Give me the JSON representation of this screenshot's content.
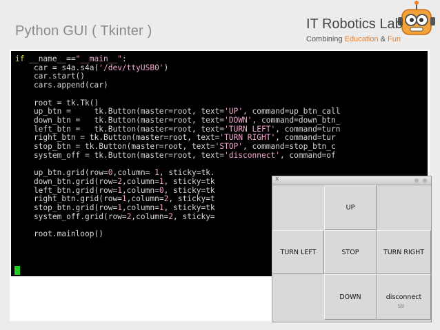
{
  "slide": {
    "title": "Python GUI ( Tkinter )",
    "brand_name": "IT Robotics Lab",
    "brand_tag_prefix": "Combining ",
    "brand_tag_education": "Education",
    "brand_tag_amp": " & ",
    "brand_tag_fun": "Fun",
    "page_number": "59",
    "accent_color": "#ef7d21"
  },
  "code_lines": [
    "if __name__==\"__main__\":",
    "    car = s4a.s4a('/dev/ttyUSB0')",
    "    car.start()",
    "    cars.append(car)",
    "",
    "    root = tk.Tk()",
    "    up_btn =     tk.Button(master=root, text='UP', command=up_btn_call",
    "    down_btn =   tk.Button(master=root, text='DOWN', command=down_btn_",
    "    left_btn =   tk.Button(master=root, text='TURN LEFT', command=turn",
    "    right_btn = tk.Button(master=root, text='TURN RIGHT', command=tur",
    "    stop_btn = tk.Button(master=root, text='STOP', command=stop_btn_c",
    "    system_off = tk.Button(master=root, text='disconnect', command=of",
    "",
    "    up_btn.grid(row=0,column= 1, sticky=tk.",
    "    down_btn.grid(row=2,column=1, sticky=tk",
    "    left_btn.grid(row=1,column=0, sticky=tk",
    "    right_btn.grid(row=1,column=2, sticky=t",
    "    stop_btn.grid(row=1,column=1, sticky=tk",
    "    system_off.grid(row=2,column=2, sticky=",
    "",
    "    root.mainloop()"
  ],
  "tk_window": {
    "close_glyph": "x",
    "buttons": {
      "up": "UP",
      "turn_left": "TURN LEFT",
      "stop": "STOP",
      "turn_right": "TURN RIGHT",
      "down": "DOWN",
      "disconnect": "disconnect"
    }
  }
}
